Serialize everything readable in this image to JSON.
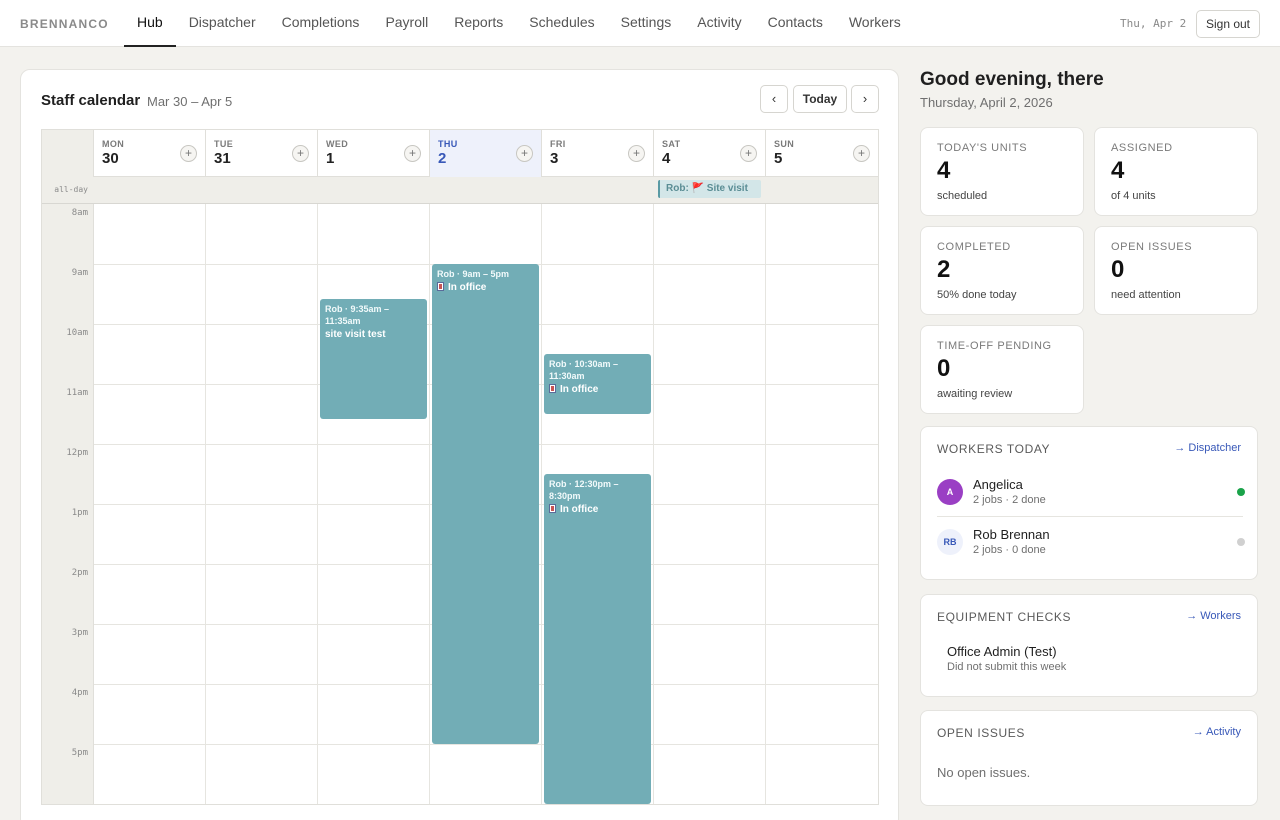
{
  "brand": "BRENNANCO",
  "nav": [
    "Hub",
    "Dispatcher",
    "Completions",
    "Payroll",
    "Reports",
    "Schedules",
    "Settings",
    "Activity",
    "Contacts",
    "Workers"
  ],
  "nav_active": "Hub",
  "nav_date": "Thu, Apr 2",
  "sign_out": "Sign out",
  "calendar": {
    "title": "Staff calendar",
    "range": "Mar 30 – Apr 5",
    "prev": "‹",
    "today_btn": "Today",
    "next": "›",
    "allday_label": "all-day",
    "days": [
      {
        "dow": "MON",
        "num": "30"
      },
      {
        "dow": "TUE",
        "num": "31"
      },
      {
        "dow": "WED",
        "num": "1"
      },
      {
        "dow": "THU",
        "num": "2"
      },
      {
        "dow": "FRI",
        "num": "3"
      },
      {
        "dow": "SAT",
        "num": "4"
      },
      {
        "dow": "SUN",
        "num": "5"
      }
    ],
    "hours": [
      "8am",
      "9am",
      "10am",
      "11am",
      "12pm",
      "1pm",
      "2pm",
      "3pm",
      "4pm",
      "5pm"
    ],
    "allday_event": "Rob: 🚩 Site visit",
    "events": [
      {
        "time": "Rob · 9:35am – 11:35am",
        "title": "site visit test"
      },
      {
        "time": "Rob · 9am – 5pm",
        "title": "In office"
      },
      {
        "time": "Rob · 10:30am – 11:30am",
        "title": "In office"
      },
      {
        "time": "Rob · 12:30pm – 8:30pm",
        "title": "In office"
      }
    ]
  },
  "greeting": "Good evening, there",
  "greeting_date": "Thursday, April 2, 2026",
  "stats": [
    {
      "label": "TODAY'S UNITS",
      "value": "4",
      "sub": "scheduled"
    },
    {
      "label": "ASSIGNED",
      "value": "4",
      "sub": "of 4 units"
    },
    {
      "label": "COMPLETED",
      "value": "2",
      "sub": "50% done today"
    },
    {
      "label": "OPEN ISSUES",
      "value": "0",
      "sub": "need attention"
    },
    {
      "label": "TIME-OFF PENDING",
      "value": "0",
      "sub": "awaiting review"
    }
  ],
  "workers_today": {
    "title": "WORKERS TODAY",
    "link": "→ Dispatcher",
    "items": [
      {
        "initials": "A",
        "name": "Angelica",
        "sub": "2 jobs · 2 done",
        "status_color": "#1aa34a"
      },
      {
        "initials": "RB",
        "name": "Rob Brennan",
        "sub": "2 jobs · 0 done",
        "status_color": "#d0d0d0"
      }
    ]
  },
  "equipment": {
    "title": "EQUIPMENT CHECKS",
    "link": "→ Workers",
    "name": "Office Admin (Test)",
    "sub": "Did not submit this week"
  },
  "open_issues": {
    "title": "OPEN ISSUES",
    "link": "→ Activity",
    "empty": "No open issues."
  },
  "colors": {
    "accent": "#3858b8",
    "event": "#72adb6",
    "today_bg": "#eef1fb"
  }
}
